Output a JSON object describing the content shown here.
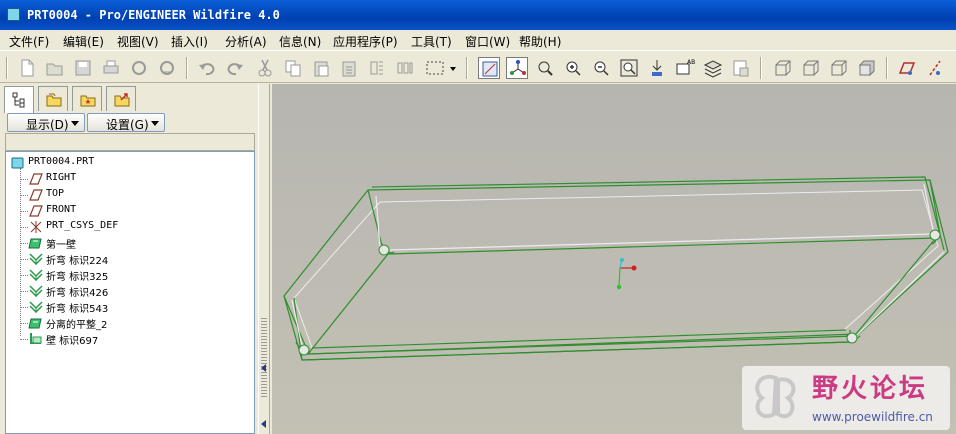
{
  "window": {
    "title": "PRT0004 - Pro/ENGINEER Wildfire 4.0",
    "icon": "part-icon"
  },
  "menu": {
    "items": [
      "文件(F)",
      "编辑(E)",
      "视图(V)",
      "插入(I)",
      "分析(A)",
      "信息(N)",
      "应用程序(P)",
      "工具(T)",
      "窗口(W)",
      "帮助(H)"
    ]
  },
  "toolbar": {
    "icons": [
      "new-icon",
      "open-icon",
      "save-icon",
      "print-icon",
      "send-icon",
      "email-icon",
      "undo-icon",
      "redo-icon",
      "cut-icon",
      "copy-icon",
      "paste-icon",
      "paste-special-icon",
      "regenerate-icon",
      "regen-manager-icon",
      "select-box-icon",
      "spin-center-icon",
      "orient-mode-icon",
      "refit-icon",
      "zoom-in-icon",
      "zoom-out-icon",
      "fit-icon",
      "reorient-icon",
      "saved-views-icon",
      "layers-icon",
      "view-manager-icon",
      "wireframe-icon",
      "hidden-line-icon",
      "no-hidden-icon",
      "shading-icon",
      "datum-plane-display-icon",
      "datum-axis-display-icon"
    ]
  },
  "left_panel": {
    "tabs": [
      "model-tree-tab",
      "folder-browser-tab",
      "favorites-tab",
      "connections-tab"
    ],
    "show_button": "显示(D)",
    "settings_button": "设置(G)",
    "tree": [
      {
        "label": "PRT0004.PRT",
        "icon": "part-icon"
      },
      {
        "label": "RIGHT",
        "icon": "datum-plane-icon"
      },
      {
        "label": "TOP",
        "icon": "datum-plane-icon"
      },
      {
        "label": "FRONT",
        "icon": "datum-plane-icon"
      },
      {
        "label": "PRT_CSYS_DEF",
        "icon": "csys-icon"
      },
      {
        "label": "第一壁",
        "icon": "first-wall-icon"
      },
      {
        "label": "折弯 标识224",
        "icon": "bend-icon"
      },
      {
        "label": "折弯 标识325",
        "icon": "bend-icon"
      },
      {
        "label": "折弯 标识426",
        "icon": "bend-icon"
      },
      {
        "label": "折弯 标识543",
        "icon": "bend-icon"
      },
      {
        "label": "分离的平整_2",
        "icon": "flat-wall-icon"
      },
      {
        "label": "壁 标识697",
        "icon": "wall-icon"
      }
    ]
  },
  "watermark": {
    "name": "野火论坛",
    "url": "www.proewildfire.cn"
  },
  "colors": {
    "titlebar": "#0a52c8",
    "model_edge": "#2f8f2f",
    "viewport_bg": "#bcbab2",
    "watermark_text": "#cc3a82"
  }
}
